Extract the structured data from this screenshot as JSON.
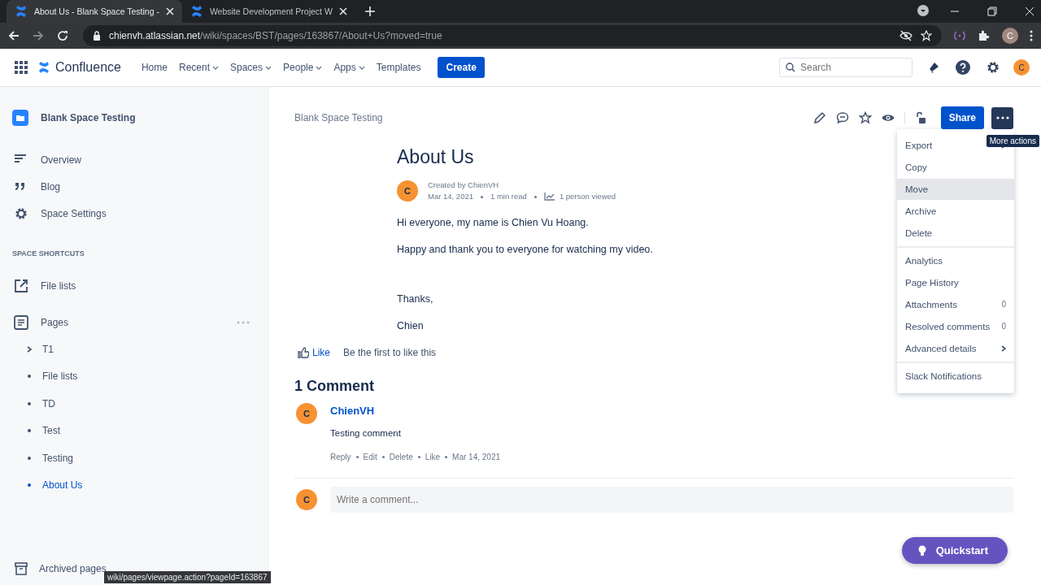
{
  "browser": {
    "tabs": [
      {
        "title": "About Us - Blank Space Testing -",
        "selected": true
      },
      {
        "title": "Website Development Project W",
        "selected": false
      }
    ],
    "address": {
      "domain": "chienvh.atlassian.net",
      "path": "/wiki/spaces/BST/pages/163867/About+Us?moved=true"
    },
    "profile_initial": "C",
    "status_url": "wiki/pages/viewpage.action?pageId=163867"
  },
  "app_header": {
    "product": "Confluence",
    "nav": [
      {
        "label": "Home",
        "dropdown": false
      },
      {
        "label": "Recent",
        "dropdown": true
      },
      {
        "label": "Spaces",
        "dropdown": true
      },
      {
        "label": "People",
        "dropdown": true
      },
      {
        "label": "Apps",
        "dropdown": true
      },
      {
        "label": "Templates",
        "dropdown": false
      }
    ],
    "create": "Create",
    "search": {
      "placeholder": "Search"
    },
    "avatar_initial": "C"
  },
  "sidebar": {
    "space_name": "Blank Space Testing",
    "items": [
      {
        "label": "Overview"
      },
      {
        "label": "Blog"
      },
      {
        "label": "Space Settings"
      }
    ],
    "shortcuts_heading": "SPACE SHORTCUTS",
    "shortcuts": [
      {
        "label": "File lists"
      }
    ],
    "pages_label": "Pages",
    "pages": [
      {
        "label": "T1",
        "kind": "parent",
        "expanded": false,
        "selected": false
      },
      {
        "label": "File lists",
        "kind": "leaf",
        "selected": false
      },
      {
        "label": "TD",
        "kind": "leaf",
        "selected": false
      },
      {
        "label": "Test",
        "kind": "leaf",
        "selected": false
      },
      {
        "label": "Testing",
        "kind": "leaf",
        "selected": false
      },
      {
        "label": "About Us",
        "kind": "leaf",
        "selected": true
      }
    ],
    "archived": "Archived pages"
  },
  "page": {
    "breadcrumb": "Blank Space Testing",
    "title": "About Us",
    "byline": {
      "avatar_initial": "C",
      "created_by": "Created by ChienVH",
      "date": "Mar 14, 2021",
      "read_time": "1 min read",
      "views": "1 person viewed"
    },
    "paragraphs": [
      "Hi everyone, my name is Chien Vu Hoang.",
      "Happy and thank you to everyone for watching my video.",
      "Thanks,",
      "Chien"
    ],
    "like": {
      "label": "Like",
      "note": "Be the first to like this"
    },
    "share": "Share",
    "tooltip": "More actions"
  },
  "menu": {
    "sections": [
      [
        {
          "label": "Export",
          "submenu": true,
          "highlighted": false
        },
        {
          "label": "Copy",
          "submenu": false,
          "highlighted": false
        },
        {
          "label": "Move",
          "submenu": false,
          "highlighted": true
        },
        {
          "label": "Archive",
          "submenu": false,
          "highlighted": false
        },
        {
          "label": "Delete",
          "submenu": false,
          "highlighted": false
        }
      ],
      [
        {
          "label": "Analytics",
          "submenu": false,
          "highlighted": false
        },
        {
          "label": "Page History",
          "submenu": false,
          "highlighted": false
        },
        {
          "label": "Attachments",
          "count": "0",
          "submenu": false,
          "highlighted": false
        },
        {
          "label": "Resolved comments",
          "count": "0",
          "submenu": false,
          "highlighted": false
        },
        {
          "label": "Advanced details",
          "submenu": true,
          "highlighted": false
        }
      ],
      [
        {
          "label": "Slack Notifications",
          "submenu": false,
          "highlighted": false
        }
      ]
    ]
  },
  "comments": {
    "heading": "1 Comment",
    "items": [
      {
        "avatar_initial": "C",
        "author": "ChienVH",
        "text": "Testing comment",
        "actions": [
          "Reply",
          "Edit",
          "Delete",
          "Like",
          "Mar 14, 2021"
        ]
      }
    ],
    "new_comment": {
      "avatar_initial": "C",
      "placeholder": "Write a comment..."
    }
  },
  "quickstart": "Quickstart"
}
